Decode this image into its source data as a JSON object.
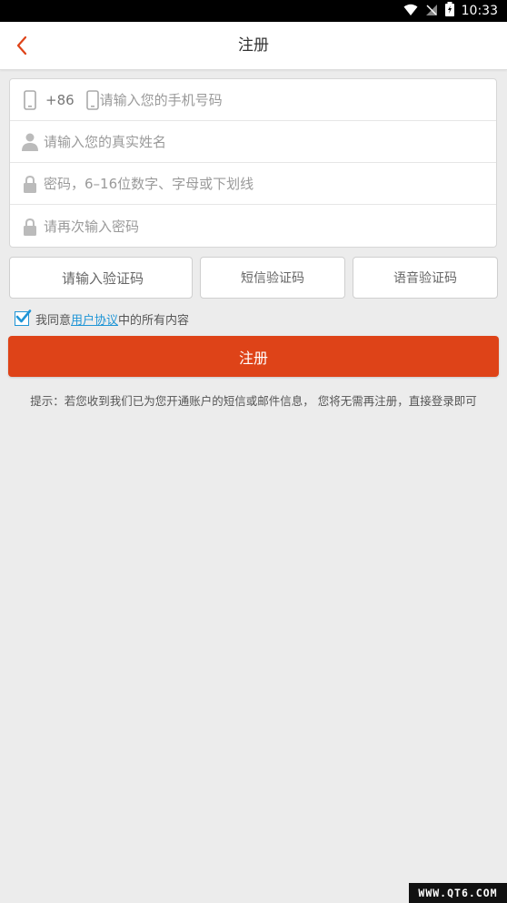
{
  "status_bar": {
    "time": "10:33"
  },
  "header": {
    "title": "注册"
  },
  "form": {
    "country_code": "+86",
    "phone_placeholder": "请输入您的手机号码",
    "name_placeholder": "请输入您的真实姓名",
    "password_placeholder": "密码，6–16位数字、字母或下划线",
    "confirm_placeholder": "请再次输入密码"
  },
  "verification": {
    "code_placeholder": "请输入验证码",
    "sms_label": "短信验证码",
    "voice_label": "语音验证码"
  },
  "agreement": {
    "prefix": "我同意",
    "link": "用户协议",
    "suffix": "中的所有内容",
    "checked": true
  },
  "register_button": {
    "label": "注册"
  },
  "tip": "提示：若您收到我们已为您开通账户的短信或邮件信息， 您将无需再注册，直接登录即可",
  "watermark": "WWW.QT6.COM",
  "colors": {
    "accent": "#de4318",
    "link": "#1f95d6",
    "background": "#ececec"
  }
}
